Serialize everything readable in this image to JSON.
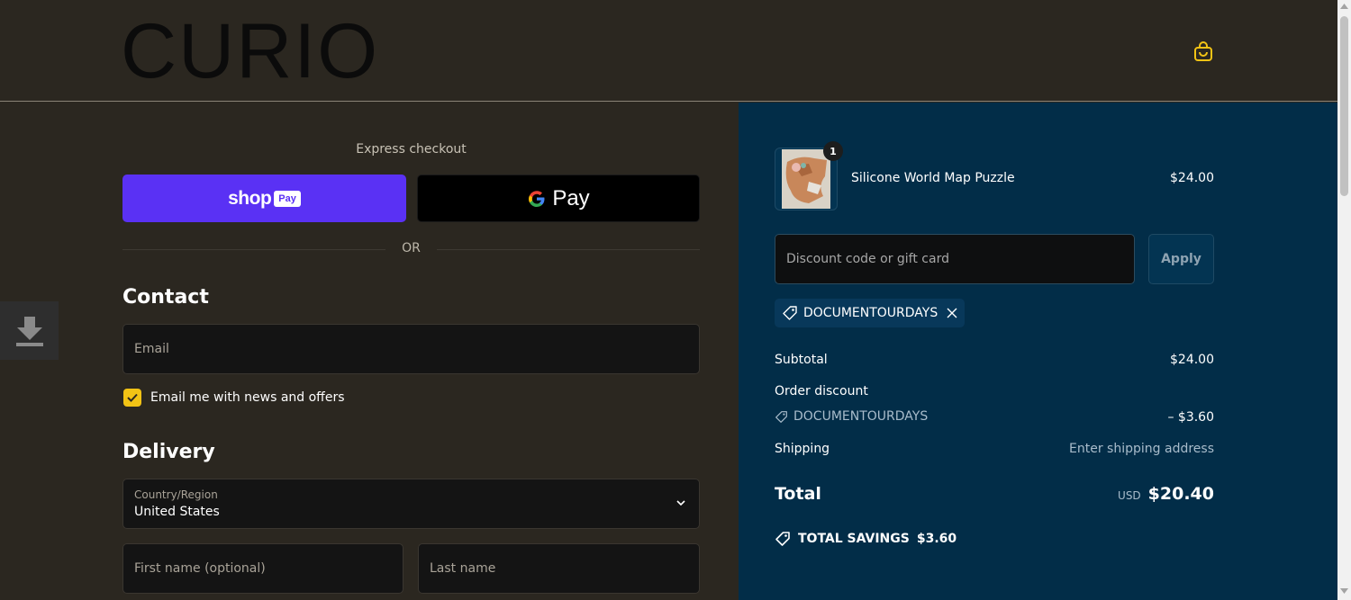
{
  "header": {
    "logo": "CURIO",
    "cart_icon": "shopping-bag-icon"
  },
  "express": {
    "label": "Express checkout",
    "shop_pay_word": "shop",
    "shop_pay_box": "Pay",
    "gpay_word": "Pay",
    "or_label": "OR"
  },
  "contact": {
    "title": "Contact",
    "email_placeholder": "Email",
    "newsletter_label": "Email me with news and offers",
    "newsletter_checked": true
  },
  "delivery": {
    "title": "Delivery",
    "country_label": "Country/Region",
    "country_value": "United States",
    "first_name_placeholder": "First name (optional)",
    "last_name_placeholder": "Last name"
  },
  "summary": {
    "product": {
      "name": "Silicone World Map Puzzle",
      "price": "$24.00",
      "quantity": "1"
    },
    "discount_placeholder": "Discount code or gift card",
    "apply_label": "Apply",
    "applied_code": "DOCUMENTOURDAYS",
    "subtotal_label": "Subtotal",
    "subtotal_value": "$24.00",
    "order_discount_label": "Order discount",
    "order_discount_code": "DOCUMENTOURDAYS",
    "order_discount_value": "– $3.60",
    "shipping_label": "Shipping",
    "shipping_value": "Enter shipping address",
    "total_label": "Total",
    "total_currency": "USD",
    "total_value": "$20.40",
    "savings_label": "TOTAL SAVINGS",
    "savings_value": "$3.60"
  },
  "colors": {
    "page_bg": "#2b2720",
    "summary_bg": "#022d48",
    "shop_pay": "#5a31f4",
    "checkbox": "#f2c315",
    "cart_icon": "#f2c315"
  }
}
